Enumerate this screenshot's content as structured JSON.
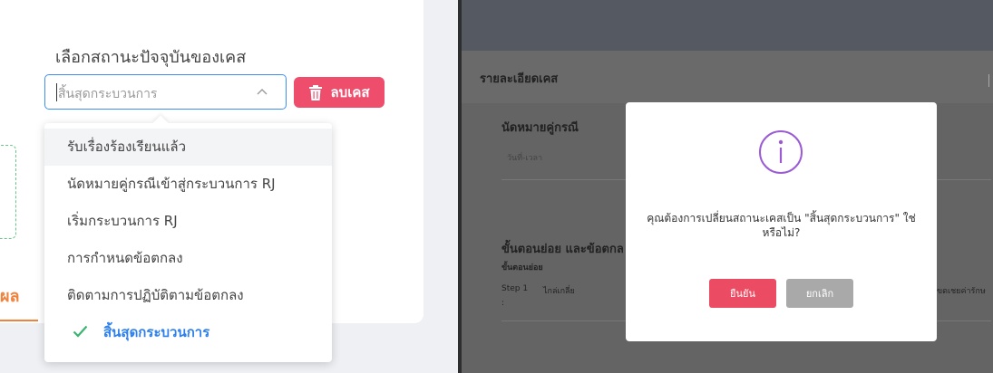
{
  "left_panel": {
    "section_label": "เลือกสถานะปัจจุบันของเคส",
    "status_select": {
      "value": "สิ้นสุดกระบวนการ",
      "icon": "chevron-up-icon"
    },
    "delete_button": {
      "label": "ลบเคส",
      "icon": "trash-icon",
      "color": "#ee4d6c"
    },
    "tab_fragment": "ผล",
    "accent_color": "#f0823c",
    "dropdown_options": [
      {
        "label": "รับเรื่องร้องเรียนแล้ว",
        "hovered": true
      },
      {
        "label": "นัดหมายคู่กรณีเข้าสู่กระบวนการ RJ"
      },
      {
        "label": "เริ่มกระบวนการ RJ"
      },
      {
        "label": "การกำหนดข้อตกลง"
      },
      {
        "label": "ติดตามการปฏิบัติตามข้อตกลง"
      },
      {
        "label": "สิ้นสุดกระบวนการ",
        "selected": true,
        "icon": "check-icon"
      }
    ]
  },
  "right_panel": {
    "header_title": "รายละเอียดเคส",
    "appointment_title": "นัดหมายคู่กรณี",
    "datetime_label": "วันที่-เวลา",
    "steps_title": "ขั้นตอนย่อย และข้อตกล",
    "substep_label": "ขั้นตอนย่อย",
    "step1": {
      "label": "Step 1",
      "colon": ":",
      "name": "ไกล่เกลี่ย"
    },
    "right_cut_text": "ขดเชยค่ารักษ",
    "modal": {
      "icon": "info-icon",
      "message": "คุณต้องการเปลี่ยนสถานะเคสเป็น \"สิ้นสุดกระบวนการ\" ใช่หรือไม่?",
      "confirm_label": "ยืนยัน",
      "cancel_label": "ยกเลิก",
      "confirm_color": "#ec4c63",
      "cancel_color": "#a9a9a9"
    }
  }
}
